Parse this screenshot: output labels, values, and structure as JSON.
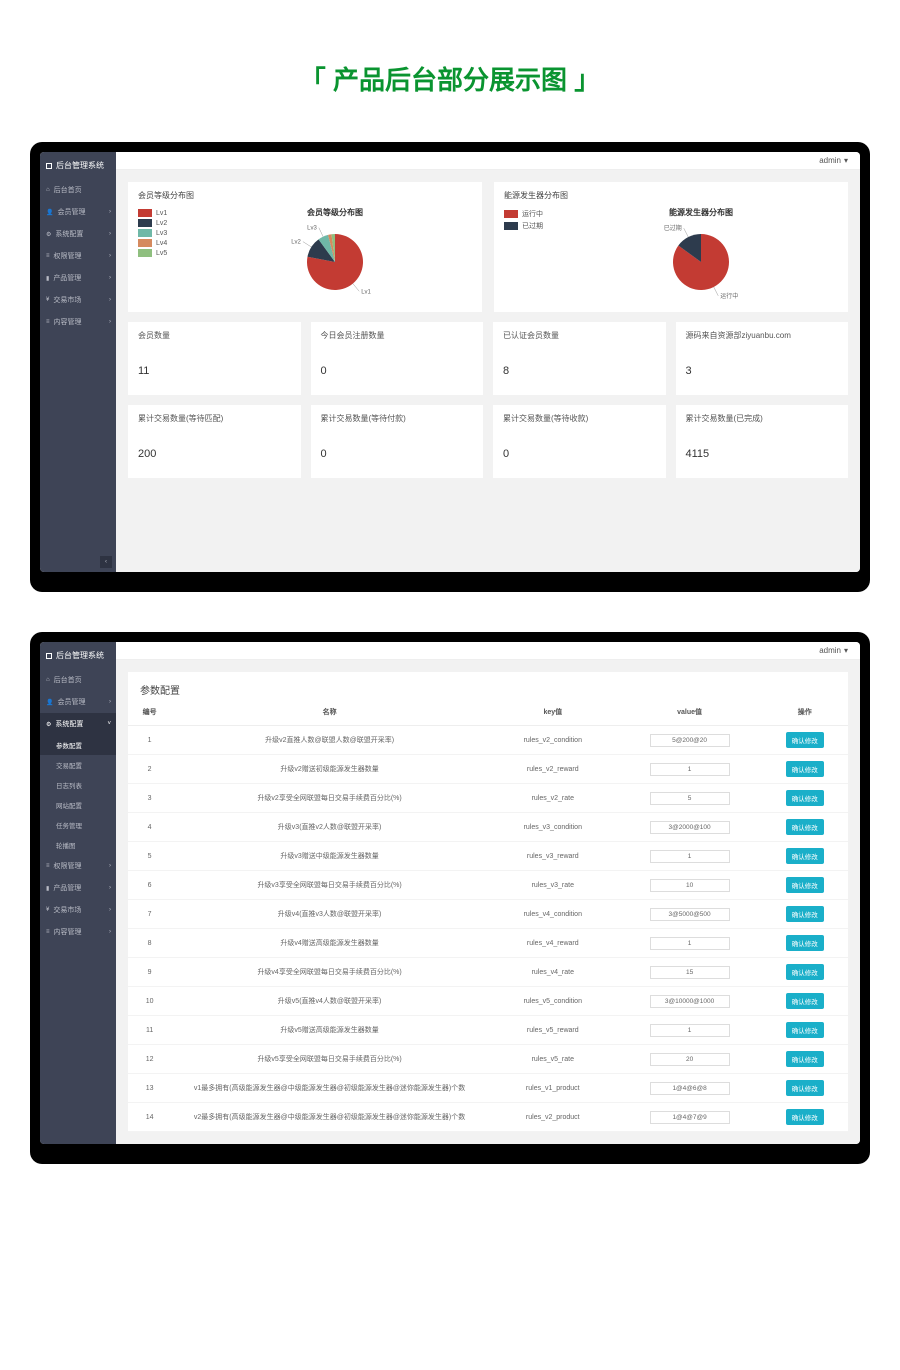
{
  "page_heading": "「 产品后台部分展示图 」",
  "header": {
    "username": "admin"
  },
  "sidebar": {
    "brand": "后台管理系统",
    "items": [
      {
        "id": "home",
        "icon": "home",
        "label": "后台首页"
      },
      {
        "id": "member",
        "icon": "user",
        "label": "会员管理"
      },
      {
        "id": "system",
        "icon": "gear",
        "label": "系统配置"
      },
      {
        "id": "perm",
        "icon": "list",
        "label": "权限管理"
      },
      {
        "id": "product",
        "icon": "chart",
        "label": "产品管理"
      },
      {
        "id": "trade",
        "icon": "rmb",
        "label": "交易市场"
      },
      {
        "id": "content",
        "icon": "list",
        "label": "内容管理"
      }
    ],
    "subitems": [
      {
        "label": "参数配置"
      },
      {
        "label": "交易配置"
      },
      {
        "label": "日志列表"
      },
      {
        "label": "网站配置"
      },
      {
        "label": "任务管理"
      },
      {
        "label": "轮播图"
      }
    ]
  },
  "chart1": {
    "panel_title": "会员等级分布图",
    "title": "会员等级分布图",
    "legend": [
      {
        "name": "Lv1",
        "color": "#c33b33"
      },
      {
        "name": "Lv2",
        "color": "#2d3b4d"
      },
      {
        "name": "Lv3",
        "color": "#6fb8a7"
      },
      {
        "name": "Lv4",
        "color": "#d58a5f"
      },
      {
        "name": "Lv5",
        "color": "#8fbf7f"
      }
    ]
  },
  "chart2": {
    "panel_title": "能源发生器分布图",
    "title": "能源发生器分布图",
    "legend": [
      {
        "name": "运行中",
        "color": "#c33b33"
      },
      {
        "name": "已过期",
        "color": "#2d3b4d"
      }
    ]
  },
  "stats_row1": [
    {
      "label": "会员数量",
      "value": "11"
    },
    {
      "label": "今日会员注册数量",
      "value": "0"
    },
    {
      "label": "已认证会员数量",
      "value": "8"
    },
    {
      "label": "源码来自资源部ziyuanbu.com",
      "value": "3"
    }
  ],
  "stats_row2": [
    {
      "label": "累计交易数量(等待匹配)",
      "value": "200"
    },
    {
      "label": "累计交易数量(等待付款)",
      "value": "0"
    },
    {
      "label": "累计交易数量(等待收款)",
      "value": "0"
    },
    {
      "label": "累计交易数量(已完成)",
      "value": "4115"
    }
  ],
  "screen2": {
    "panel_title": "参数配置",
    "columns": {
      "idx": "编号",
      "name": "名称",
      "key": "key值",
      "value": "value值",
      "action": "操作"
    },
    "action_label": "确认修改",
    "rows": [
      {
        "idx": "1",
        "name": "升级v2直推人数@联盟人数@联盟开采率)",
        "key": "rules_v2_condition",
        "value": "5@200@20"
      },
      {
        "idx": "2",
        "name": "升级v2赠送初级能源发生器数量",
        "key": "rules_v2_reward",
        "value": "1"
      },
      {
        "idx": "3",
        "name": "升级v2享受全网联盟每日交易手续费百分比(%)",
        "key": "rules_v2_rate",
        "value": "5"
      },
      {
        "idx": "4",
        "name": "升级v3(直推v2人数@联盟开采率)",
        "key": "rules_v3_condition",
        "value": "3@2000@100"
      },
      {
        "idx": "5",
        "name": "升级v3赠送中级能源发生器数量",
        "key": "rules_v3_reward",
        "value": "1"
      },
      {
        "idx": "6",
        "name": "升级v3享受全网联盟每日交易手续费百分比(%)",
        "key": "rules_v3_rate",
        "value": "10"
      },
      {
        "idx": "7",
        "name": "升级v4(直推v3人数@联盟开采率)",
        "key": "rules_v4_condition",
        "value": "3@5000@500"
      },
      {
        "idx": "8",
        "name": "升级v4赠送高级能源发生器数量",
        "key": "rules_v4_reward",
        "value": "1"
      },
      {
        "idx": "9",
        "name": "升级v4享受全网联盟每日交易手续费百分比(%)",
        "key": "rules_v4_rate",
        "value": "15"
      },
      {
        "idx": "10",
        "name": "升级v5(直推v4人数@联盟开采率)",
        "key": "rules_v5_condition",
        "value": "3@10000@1000"
      },
      {
        "idx": "11",
        "name": "升级v5赠送高级能源发生器数量",
        "key": "rules_v5_reward",
        "value": "1"
      },
      {
        "idx": "12",
        "name": "升级v5享受全网联盟每日交易手续费百分比(%)",
        "key": "rules_v5_rate",
        "value": "20"
      },
      {
        "idx": "13",
        "name": "v1最多拥有(高级能源发生器@中级能源发生器@初级能源发生器@迷你能源发生器)个数",
        "key": "rules_v1_product",
        "value": "1@4@6@8"
      },
      {
        "idx": "14",
        "name": "v2最多拥有(高级能源发生器@中级能源发生器@初级能源发生器@迷你能源发生器)个数",
        "key": "rules_v2_product",
        "value": "1@4@7@9"
      }
    ]
  },
  "chart_data": [
    {
      "type": "pie",
      "title": "会员等级分布图",
      "series": [
        {
          "name": "Lv1",
          "value": 78,
          "color": "#c33b33"
        },
        {
          "name": "Lv2",
          "value": 12,
          "color": "#2d3b4d"
        },
        {
          "name": "Lv3",
          "value": 6,
          "color": "#6fb8a7"
        },
        {
          "name": "Lv4",
          "value": 2,
          "color": "#d58a5f"
        },
        {
          "name": "Lv5",
          "value": 2,
          "color": "#8fbf7f"
        }
      ]
    },
    {
      "type": "pie",
      "title": "能源发生器分布图",
      "series": [
        {
          "name": "运行中",
          "value": 85,
          "color": "#c33b33"
        },
        {
          "name": "已过期",
          "value": 15,
          "color": "#2d3b4d"
        }
      ]
    }
  ]
}
